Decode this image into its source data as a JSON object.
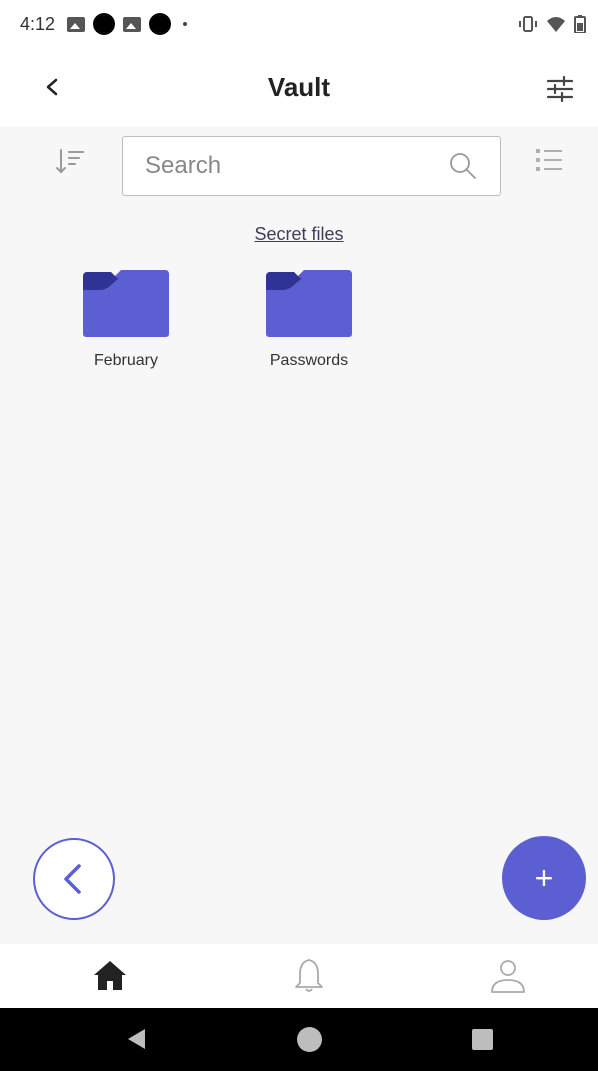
{
  "status_bar": {
    "time": "4:12",
    "icons_left": [
      "image-icon",
      "notification-dot-icon",
      "photo-icon",
      "notification-dot-icon",
      "small-dot-icon"
    ],
    "icons_right": [
      "vibrate-icon",
      "wifi-icon",
      "battery-icon"
    ]
  },
  "app_bar": {
    "title": "Vault",
    "back_icon": "chevron-left-icon",
    "filter_icon": "sliders-icon"
  },
  "toolbar": {
    "sort_icon": "sort-icon",
    "search_placeholder": "Search",
    "search_value": "",
    "list_view_icon": "list-view-icon"
  },
  "section": {
    "title": "Secret files"
  },
  "folders": [
    {
      "name": "February",
      "icon": "folder-icon"
    },
    {
      "name": "Passwords",
      "icon": "folder-icon"
    }
  ],
  "fabs": {
    "back_icon": "chevron-left-icon",
    "add_label": "+"
  },
  "bottom_nav": {
    "items": [
      {
        "name": "home",
        "icon": "home-icon",
        "active": true
      },
      {
        "name": "notifications",
        "icon": "bell-icon",
        "active": false
      },
      {
        "name": "profile",
        "icon": "user-icon",
        "active": false
      }
    ]
  },
  "colors": {
    "accent": "#5b5fd1",
    "folder_body": "#5b5fd1",
    "folder_tab": "#2e3394",
    "background": "#f7f7f7"
  }
}
